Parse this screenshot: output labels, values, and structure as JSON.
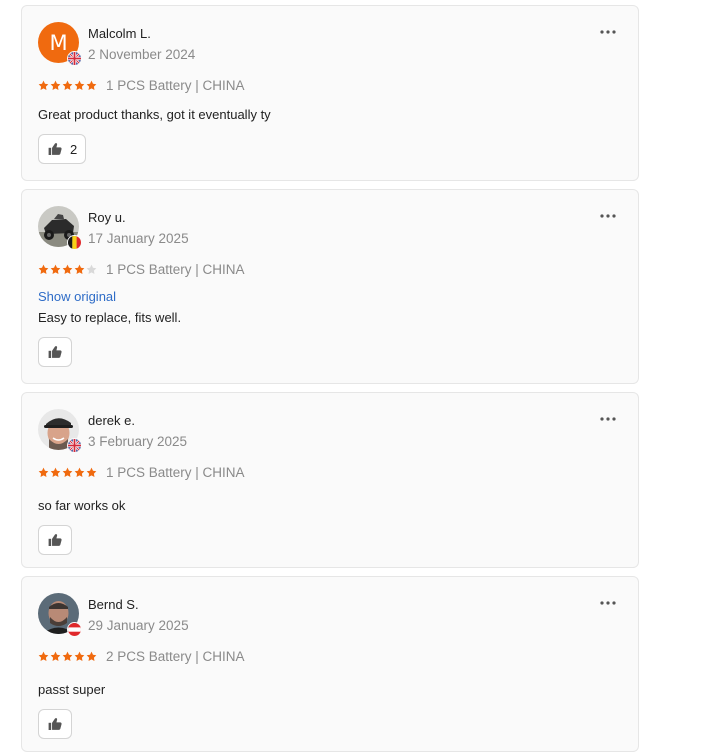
{
  "colors": {
    "star_filled": "#f06a0f",
    "star_empty": "#d9d9d9",
    "link": "#2e6cc7",
    "avatar_letter_bg": "#f06a0f"
  },
  "reviews": [
    {
      "name": "Malcolm L.",
      "date": "2 November 2024",
      "avatar_type": "letter",
      "avatar_letter": "M",
      "flag": "uk-flag-icon",
      "rating": 5,
      "max_rating": 5,
      "variant": "1 PCS Battery | CHINA",
      "show_original": "",
      "text": "Great product thanks, got it eventually ty",
      "helpful_count": "2",
      "more_icon": "more-horizontal-icon",
      "helpful_icon": "thumbs-up-icon"
    },
    {
      "name": "Roy u.",
      "date": "17 January 2025",
      "avatar_type": "photo",
      "avatar_letter": "",
      "flag": "belgium-flag-icon",
      "rating": 4,
      "max_rating": 5,
      "variant": "1 PCS Battery | CHINA",
      "show_original": "Show original",
      "text": "Easy to replace, fits well.",
      "helpful_count": "",
      "more_icon": "more-horizontal-icon",
      "helpful_icon": "thumbs-up-icon"
    },
    {
      "name": "derek e.",
      "date": "3 February 2025",
      "avatar_type": "photo",
      "avatar_letter": "",
      "flag": "uk-flag-icon",
      "rating": 5,
      "max_rating": 5,
      "variant": "1 PCS Battery | CHINA",
      "show_original": "",
      "text": "so far works ok",
      "helpful_count": "",
      "more_icon": "more-horizontal-icon",
      "helpful_icon": "thumbs-up-icon"
    },
    {
      "name": "Bernd S.",
      "date": "29 January 2025",
      "avatar_type": "photo",
      "avatar_letter": "",
      "flag": "austria-flag-icon",
      "rating": 5,
      "max_rating": 5,
      "variant": "2 PCS Battery | CHINA",
      "show_original": "",
      "text": "passt super",
      "helpful_count": "",
      "more_icon": "more-horizontal-icon",
      "helpful_icon": "thumbs-up-icon"
    }
  ]
}
